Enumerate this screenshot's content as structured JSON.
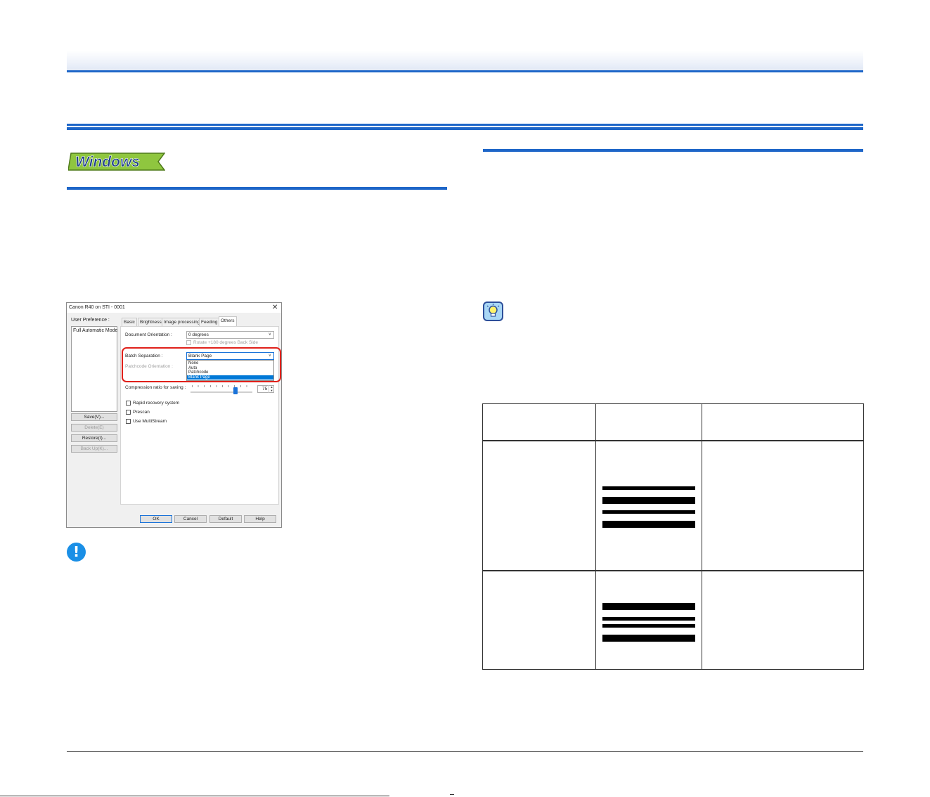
{
  "page": {
    "badge": "Windows"
  },
  "dialog": {
    "title": "Canon R40 on STI - 0001",
    "close_glyph": "✕",
    "user_preference_label": "User Preference :",
    "user_preference_items": [
      "Full Automatic Mode"
    ],
    "side_buttons": [
      "Save(V)...",
      "Delete(E)",
      "Restore(I)...",
      "Back Up(K)..."
    ],
    "tabs": [
      "Basic",
      "Brightness",
      "Image processing",
      "Feeding",
      "Others"
    ],
    "active_tab": "Others",
    "document_orientation_label": "Document Orientation :",
    "document_orientation_value": "0 degrees",
    "rotate_label": "Rotate +180 degrees Back Side",
    "batch_separation_label": "Batch Separation :",
    "batch_separation_value": "Blank Page",
    "batch_options": [
      "None",
      "Auto",
      "Patchcode",
      "Blank Page"
    ],
    "selected_option": "Blank Page",
    "patchcode_orientation_label": "Patchcode Orientation :",
    "compression_label": "Compression ratio for saving :",
    "compression_value": "75",
    "compression_level": 0.75,
    "checkboxes": [
      "Rapid recovery system",
      "Prescan",
      "Use MultiStream"
    ],
    "footer_buttons": [
      "OK",
      "Cancel",
      "Default",
      "Help"
    ]
  },
  "icons": {
    "important": "exclamation-icon",
    "hint": "lightbulb-icon",
    "important_glyph": "!"
  },
  "colors": {
    "accent_blue": "#1e66c8",
    "highlight_red": "#e0201a",
    "badge_green": "#8fc63f",
    "selection_blue": "#0078d7"
  }
}
